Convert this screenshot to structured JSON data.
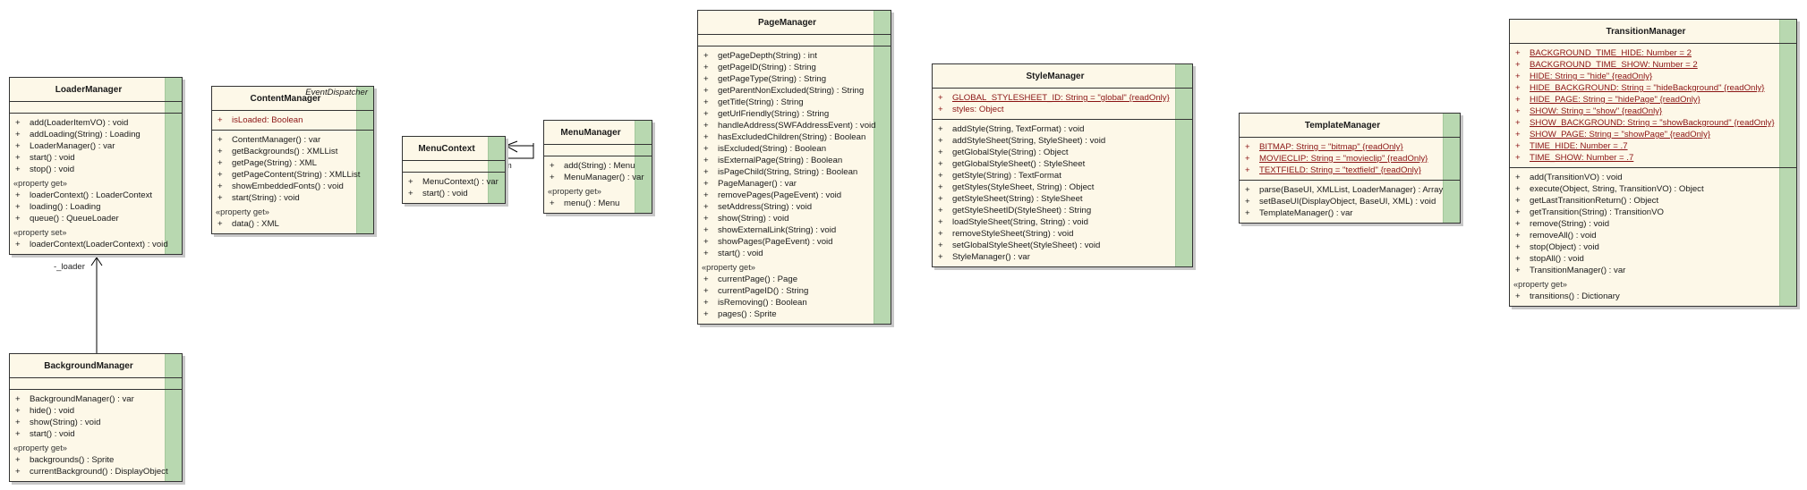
{
  "classes": {
    "loader": {
      "name": "LoaderManager",
      "attributes": [],
      "groups": [
        {
          "label": "",
          "rows": [
            {
              "vis": "+",
              "text": "add(LoaderItemVO) : void"
            },
            {
              "vis": "+",
              "text": "addLoading(String) : Loading"
            },
            {
              "vis": "+",
              "text": "LoaderManager() : var"
            },
            {
              "vis": "+",
              "text": "start() : void"
            },
            {
              "vis": "+",
              "text": "stop() : void"
            }
          ]
        },
        {
          "label": "«property get»",
          "rows": [
            {
              "vis": "+",
              "text": "loaderContext() : LoaderContext"
            },
            {
              "vis": "+",
              "text": "loading() : Loading"
            },
            {
              "vis": "+",
              "text": "queue() : QueueLoader"
            }
          ]
        },
        {
          "label": "«property set»",
          "rows": [
            {
              "vis": "+",
              "text": "loaderContext(LoaderContext) : void"
            }
          ]
        }
      ]
    },
    "content": {
      "name": "ContentManager",
      "stereotype": "EventDispatcher",
      "attributes": [
        {
          "vis": "+",
          "text": "isLoaded:  Boolean"
        }
      ],
      "groups": [
        {
          "label": "",
          "rows": [
            {
              "vis": "+",
              "text": "ContentManager() : var"
            },
            {
              "vis": "+",
              "text": "getBackgrounds() : XMLList"
            },
            {
              "vis": "+",
              "text": "getPage(String) : XML"
            },
            {
              "vis": "+",
              "text": "getPageContent(String) : XMLList"
            },
            {
              "vis": "+",
              "text": "showEmbeddedFonts() : void"
            },
            {
              "vis": "+",
              "text": "start(String) : void"
            }
          ]
        },
        {
          "label": "«property get»",
          "rows": [
            {
              "vis": "+",
              "text": "data() : XML"
            }
          ]
        }
      ]
    },
    "menucontext": {
      "name": "MenuContext",
      "attributes": [],
      "groups": [
        {
          "label": "",
          "rows": [
            {
              "vis": "+",
              "text": "MenuContext() : var"
            },
            {
              "vis": "+",
              "text": "start() : void"
            }
          ]
        }
      ]
    },
    "menu": {
      "name": "MenuManager",
      "attributes": [],
      "groups": [
        {
          "label": "",
          "rows": [
            {
              "vis": "+",
              "text": "add(String) : Menu"
            },
            {
              "vis": "+",
              "text": "MenuManager() : var"
            }
          ]
        },
        {
          "label": "«property get»",
          "rows": [
            {
              "vis": "+",
              "text": "menu() : Menu"
            }
          ]
        }
      ]
    },
    "page": {
      "name": "PageManager",
      "attributes": [],
      "groups": [
        {
          "label": "",
          "rows": [
            {
              "vis": "+",
              "text": "getPageDepth(String) : int"
            },
            {
              "vis": "+",
              "text": "getPageID(String) : String"
            },
            {
              "vis": "+",
              "text": "getPageType(String) : String"
            },
            {
              "vis": "+",
              "text": "getParentNonExcluded(String) : String"
            },
            {
              "vis": "+",
              "text": "getTitle(String) : String"
            },
            {
              "vis": "+",
              "text": "getUrlFriendly(String) : String"
            },
            {
              "vis": "+",
              "text": "handleAddress(SWFAddressEvent) : void"
            },
            {
              "vis": "+",
              "text": "hasExcludedChildren(String) : Boolean"
            },
            {
              "vis": "+",
              "text": "isExcluded(String) : Boolean"
            },
            {
              "vis": "+",
              "text": "isExternalPage(String) : Boolean"
            },
            {
              "vis": "+",
              "text": "isPageChild(String, String) : Boolean"
            },
            {
              "vis": "+",
              "text": "PageManager() : var"
            },
            {
              "vis": "+",
              "text": "removePages(PageEvent) : void"
            },
            {
              "vis": "+",
              "text": "setAddress(String) : void"
            },
            {
              "vis": "+",
              "text": "show(String) : void"
            },
            {
              "vis": "+",
              "text": "showExternalLink(String) : void"
            },
            {
              "vis": "+",
              "text": "showPages(PageEvent) : void"
            },
            {
              "vis": "+",
              "text": "start() : void"
            }
          ]
        },
        {
          "label": "«property get»",
          "rows": [
            {
              "vis": "+",
              "text": "currentPage() : Page"
            },
            {
              "vis": "+",
              "text": "currentPageID() : String"
            },
            {
              "vis": "+",
              "text": "isRemoving() : Boolean"
            },
            {
              "vis": "+",
              "text": "pages() : Sprite"
            }
          ]
        }
      ]
    },
    "style": {
      "name": "StyleManager",
      "attributes": [
        {
          "vis": "+",
          "text": "GLOBAL_STYLESHEET_ID:  String = \"global\" {readOnly}",
          "static": true
        },
        {
          "vis": "+",
          "text": "styles:  Object"
        }
      ],
      "groups": [
        {
          "label": "",
          "rows": [
            {
              "vis": "+",
              "text": "addStyle(String, TextFormat) : void"
            },
            {
              "vis": "+",
              "text": "addStyleSheet(String, StyleSheet) : void"
            },
            {
              "vis": "+",
              "text": "getGlobalStyle(String) : Object"
            },
            {
              "vis": "+",
              "text": "getGlobalStyleSheet() : StyleSheet"
            },
            {
              "vis": "+",
              "text": "getStyle(String) : TextFormat"
            },
            {
              "vis": "+",
              "text": "getStyles(StyleSheet, String) : Object"
            },
            {
              "vis": "+",
              "text": "getStyleSheet(String) : StyleSheet"
            },
            {
              "vis": "+",
              "text": "getStyleSheetID(StyleSheet) : String"
            },
            {
              "vis": "+",
              "text": "loadStyleSheet(String, String) : void"
            },
            {
              "vis": "+",
              "text": "removeStyleSheet(String) : void"
            },
            {
              "vis": "+",
              "text": "setGlobalStyleSheet(StyleSheet) : void"
            },
            {
              "vis": "+",
              "text": "StyleManager() : var"
            }
          ]
        }
      ]
    },
    "template": {
      "name": "TemplateManager",
      "attributes": [
        {
          "vis": "+",
          "text": "BITMAP:  String = \"bitmap\" {readOnly}",
          "static": true
        },
        {
          "vis": "+",
          "text": "MOVIECLIP:  String = \"movieclip\" {readOnly}",
          "static": true
        },
        {
          "vis": "+",
          "text": "TEXTFIELD:  String = \"textfield\" {readOnly}",
          "static": true
        }
      ],
      "groups": [
        {
          "label": "",
          "rows": [
            {
              "vis": "+",
              "text": "parse(BaseUI, XMLList, LoaderManager) : Array"
            },
            {
              "vis": "+",
              "text": "setBaseUI(DisplayObject, BaseUI, XML) : void"
            },
            {
              "vis": "+",
              "text": "TemplateManager() : var"
            }
          ]
        }
      ]
    },
    "transition": {
      "name": "TransitionManager",
      "attributes": [
        {
          "vis": "+",
          "text": "BACKGROUND_TIME_HIDE:  Number = 2",
          "static": true
        },
        {
          "vis": "+",
          "text": "BACKGROUND_TIME_SHOW:  Number = 2",
          "static": true
        },
        {
          "vis": "+",
          "text": "HIDE:  String = \"hide\" {readOnly}",
          "static": true
        },
        {
          "vis": "+",
          "text": "HIDE_BACKGROUND:  String = \"hideBackground\" {readOnly}",
          "static": true
        },
        {
          "vis": "+",
          "text": "HIDE_PAGE:  String = \"hidePage\" {readOnly}",
          "static": true
        },
        {
          "vis": "+",
          "text": "SHOW:  String = \"show\" {readOnly}",
          "static": true
        },
        {
          "vis": "+",
          "text": "SHOW_BACKGROUND:  String = \"showBackground\" {readOnly}",
          "static": true
        },
        {
          "vis": "+",
          "text": "SHOW_PAGE:  String = \"showPage\" {readOnly}",
          "static": true
        },
        {
          "vis": "+",
          "text": "TIME_HIDE:  Number = .7",
          "static": true
        },
        {
          "vis": "+",
          "text": "TIME_SHOW:  Number = .7",
          "static": true
        }
      ],
      "groups": [
        {
          "label": "",
          "rows": [
            {
              "vis": "+",
              "text": "add(TransitionVO) : void"
            },
            {
              "vis": "+",
              "text": "execute(Object, String, TransitionVO) : Object"
            },
            {
              "vis": "+",
              "text": "getLastTransitionReturn() : Object"
            },
            {
              "vis": "+",
              "text": "getTransition(String) : TransitionVO"
            },
            {
              "vis": "+",
              "text": "remove(String) : void"
            },
            {
              "vis": "+",
              "text": "removeAll() : void"
            },
            {
              "vis": "+",
              "text": "stop(Object) : void"
            },
            {
              "vis": "+",
              "text": "stopAll() : void"
            },
            {
              "vis": "+",
              "text": "TransitionManager() : var"
            }
          ]
        },
        {
          "label": "«property get»",
          "rows": [
            {
              "vis": "+",
              "text": "transitions() : Dictionary"
            }
          ]
        }
      ]
    },
    "background": {
      "name": "BackgroundManager",
      "attributes": [],
      "groups": [
        {
          "label": "",
          "rows": [
            {
              "vis": "+",
              "text": "BackgroundManager() : var"
            },
            {
              "vis": "+",
              "text": "hide() : void"
            },
            {
              "vis": "+",
              "text": "show(String) : void"
            },
            {
              "vis": "+",
              "text": "start() : void"
            }
          ]
        },
        {
          "label": "«property get»",
          "rows": [
            {
              "vis": "+",
              "text": "backgrounds() : Sprite"
            },
            {
              "vis": "+",
              "text": "currentBackground() : DisplayObject"
            }
          ]
        }
      ]
    }
  },
  "associations": {
    "loader_role": "-_loader",
    "menu_role": "-cm"
  }
}
